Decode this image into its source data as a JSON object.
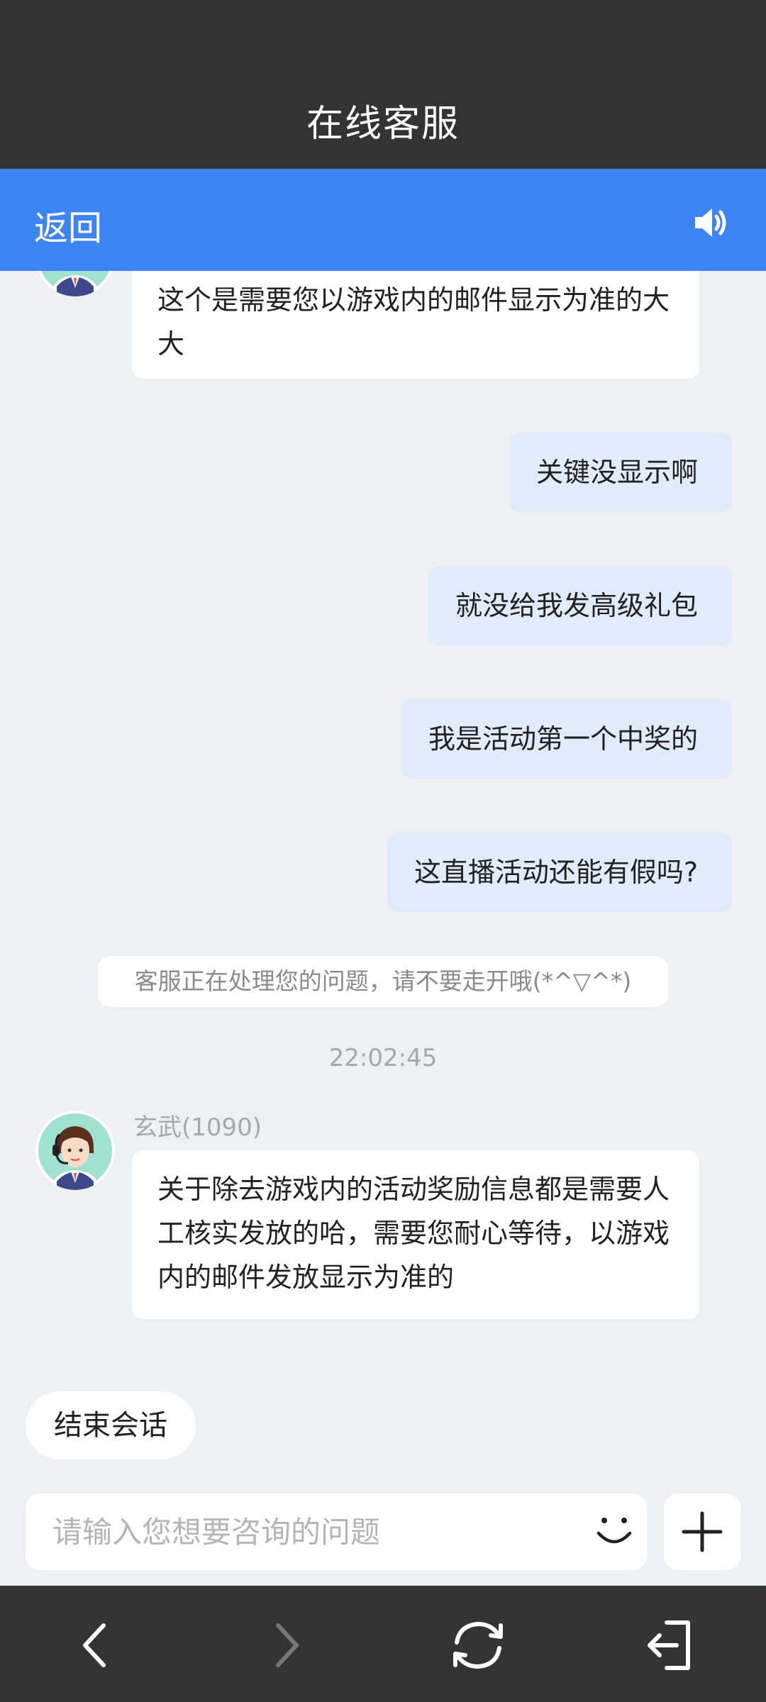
{
  "header": {
    "title": "在线客服"
  },
  "nav": {
    "back_label": "返回",
    "speaker_icon": "speaker-icon"
  },
  "messages": {
    "m1": "这个是需要您以游戏内的邮件显示为准的大大",
    "u1": "关键没显示啊",
    "u2": "就没给我发高级礼包",
    "u3": "我是活动第一个中奖的",
    "u4": "这直播活动还能有假吗?",
    "notice": "客服正在处理您的问题，请不要走开哦(*^▽^*)",
    "time": "22:02:45",
    "agent_name": "玄武(1090)",
    "m2": "关于除去游戏内的活动奖励信息都是需要人工核实发放的哈，需要您耐心等待，以游戏内的邮件发放显示为准的"
  },
  "actions": {
    "end_session": "结束会话"
  },
  "input": {
    "placeholder": "请输入您想要咨询的问题",
    "value": ""
  },
  "colors": {
    "title_bar": "#333333",
    "nav_bar": "#3d85f6",
    "background": "#eef0f4",
    "user_bubble": "#e1ecfb"
  },
  "bottom_nav": [
    "back-arrow-icon",
    "forward-arrow-icon",
    "refresh-icon",
    "exit-icon"
  ]
}
